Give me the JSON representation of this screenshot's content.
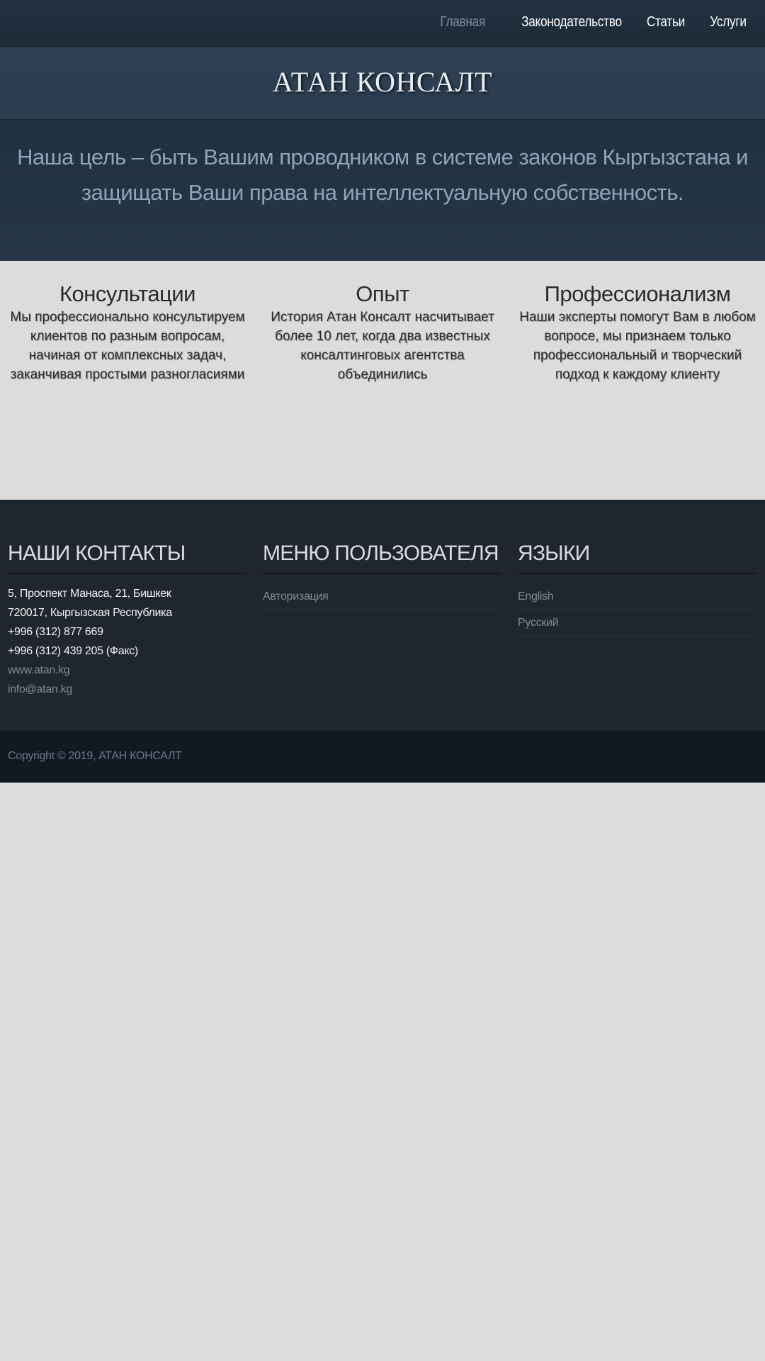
{
  "nav": {
    "items": [
      {
        "label": "Главная",
        "active": true
      },
      {
        "label": "Законодательство",
        "active": false
      },
      {
        "label": "Статьи",
        "active": false
      },
      {
        "label": "Услуги",
        "active": false
      }
    ]
  },
  "header": {
    "site_title": "АТАН КОНСАЛТ"
  },
  "hero": {
    "text": "Наша цель – быть Вашим проводником в системе законов Кыргызстана и защищать Ваши права на интеллектуальную собственность."
  },
  "features": [
    {
      "title": "Консультации",
      "text": "Мы профессионально консультируем клиентов по разным вопросам, начиная от комплексных задач, заканчивая простыми разногласиями"
    },
    {
      "title": "Опыт",
      "text": "История Атан Консалт насчитывает более 10 лет, когда два известных консалтинговых агентства объединились"
    },
    {
      "title": "Профессионализм",
      "text": "Наши эксперты помогут Вам в любом вопросе, мы признаем только профессиональный и творческий подход к каждому клиенту"
    }
  ],
  "footer": {
    "contacts": {
      "heading": "НАШИ КОНТАКТЫ",
      "address_line1": "5, Проспект Манаса, 21, Бишкек",
      "address_line2": "720017, Кыргызская Республика",
      "phone": "+996 (312) 877 669",
      "fax": "+996 (312) 439 205 (Факс)",
      "website": "www.atan.kg",
      "email": "info@atan.kg"
    },
    "user_menu": {
      "heading": "МЕНЮ ПОЛЬЗОВАТЕЛЯ",
      "items": [
        "Авторизация"
      ]
    },
    "languages": {
      "heading": "ЯЗЫКИ",
      "items": [
        "English",
        "Русский"
      ]
    }
  },
  "copyright": "Copyright © 2019, АТАН КОНСАЛТ",
  "colors": {
    "nav_bg": "#1f2d3a",
    "title_band_bg": "#2d3e50",
    "hero_text": "#8fa5b8",
    "page_bg": "#dcdcdc",
    "footer_bg": "#20262d",
    "copyright_bg": "#111923",
    "link_muted": "#7d8b98"
  }
}
